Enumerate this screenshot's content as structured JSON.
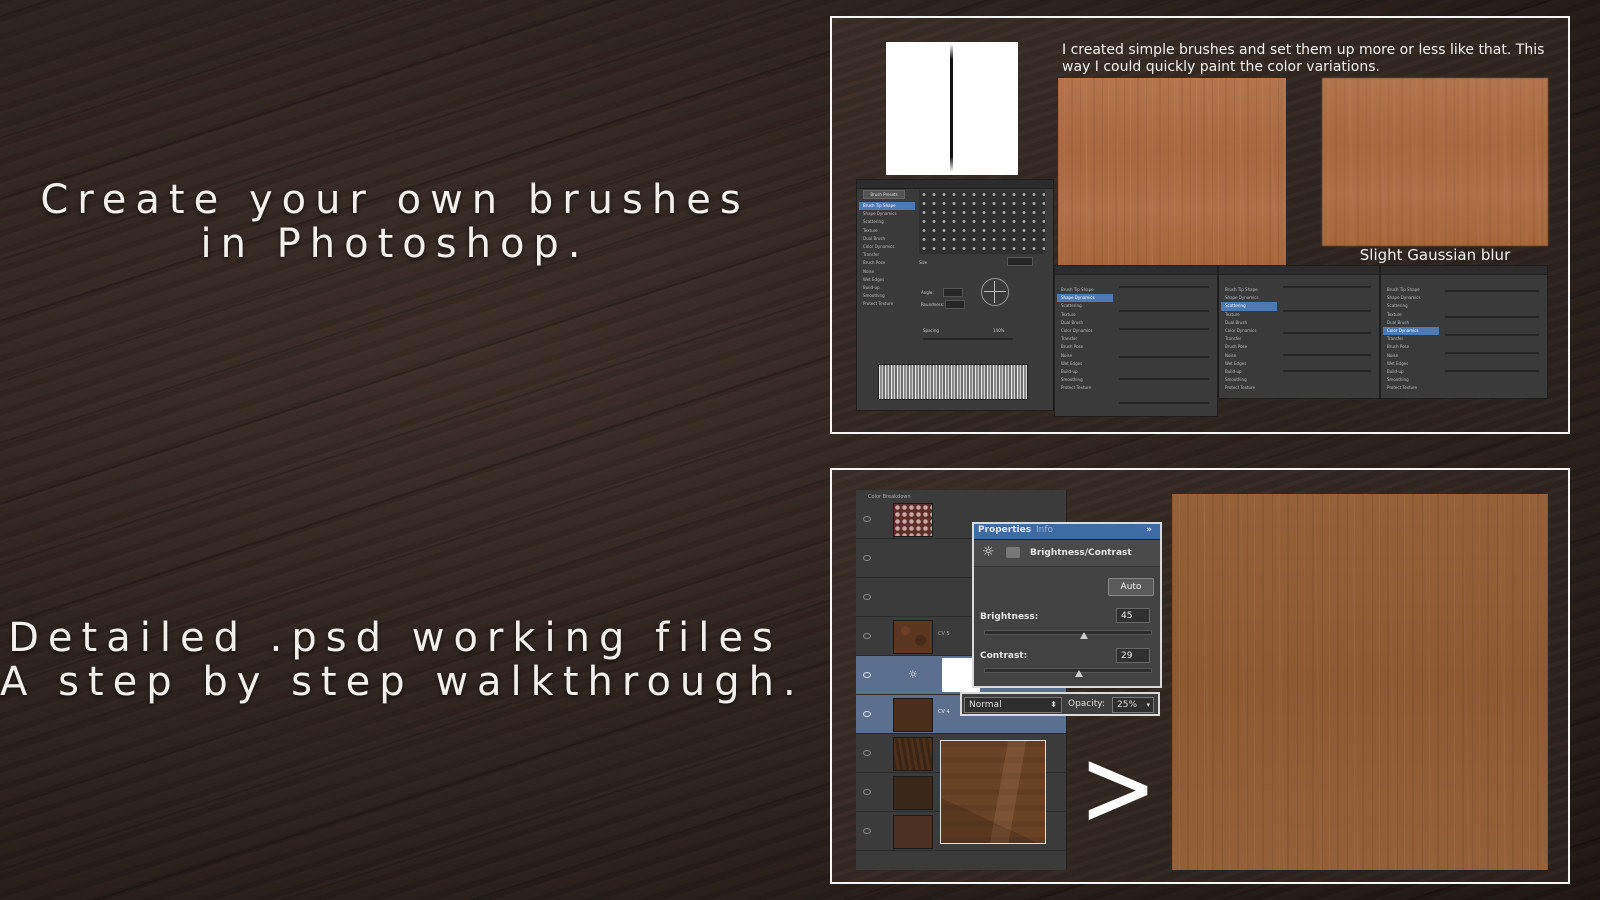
{
  "headline_top": {
    "line1": "Create your own brushes",
    "line2": "in Photoshop."
  },
  "headline_bottom": {
    "line1": "Detailed .psd working files",
    "line2": "A step by step walkthrough."
  },
  "panel_brushes": {
    "caption": "I created simple brushes and set them up more or less like that. This way I could quickly paint the color variations.",
    "blur_label": "Slight Gaussian blur",
    "brush_settings_items": [
      "Brush Tip Shape",
      "Shape Dynamics",
      "Scattering",
      "Texture",
      "Dual Brush",
      "Color Dynamics",
      "Transfer",
      "Brush Pose",
      "Noise",
      "Wet Edges",
      "Build-up",
      "Smoothing",
      "Protect Texture"
    ],
    "presets_button": "Brush Presets",
    "spacing_label": "Spacing",
    "spacing_value": "140%",
    "size_label": "Size",
    "angle_label": "Angle:",
    "roundness_label": "Roundness:"
  },
  "panel_layers": {
    "group_name": "Color Breakdown",
    "layer_names": [
      "",
      "",
      "",
      "CV 5",
      "",
      "CV 4",
      "",
      "",
      ""
    ],
    "properties": {
      "tab_properties": "Properties",
      "tab_info": "Info",
      "adjustment_name": "Brightness/Contrast",
      "auto_label": "Auto",
      "brightness_label": "Brightness:",
      "brightness_value": "45",
      "brightness_level": 0.6,
      "contrast_label": "Contrast:",
      "contrast_value": "29",
      "contrast_level": 0.57
    },
    "blend_mode": "Normal",
    "opacity_label": "Opacity:",
    "opacity_value": "25%",
    "arrow_glyph": ">"
  },
  "colors": {
    "accent": "#4d7ab5",
    "wood": "#a9693f",
    "frame": "#f4f4f4"
  }
}
